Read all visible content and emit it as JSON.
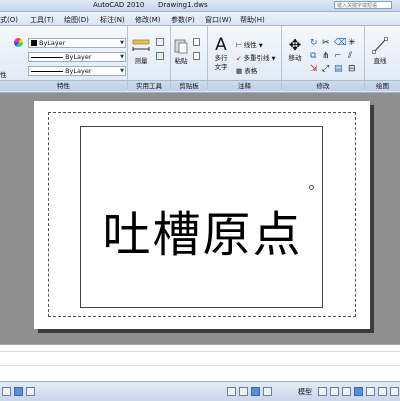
{
  "titlebar": {
    "app_title": "AutoCAD 2010",
    "document_title": "Drawing1.dws",
    "search_placeholder": "键入关键字或短语"
  },
  "menu": {
    "items": [
      "式(O)",
      "工具(T)",
      "绘图(D)",
      "标注(N)",
      "修改(M)",
      "参数(P)",
      "窗口(W)",
      "帮助(H)"
    ]
  },
  "ribbon": {
    "properties": {
      "color_value": "ByLayer",
      "linetype_value": "ByLayer",
      "lineweight_value": "ByLayer",
      "left_cut_label": "性",
      "panel_label": "特性"
    },
    "utilities": {
      "measure_label": "测量",
      "panel_label": "实用工具"
    },
    "clipboard": {
      "paste_label": "粘贴",
      "panel_label": "剪贴板"
    },
    "annotation": {
      "mtext_label_1": "多行",
      "mtext_label_2": "文字",
      "linear_label": "线性",
      "mleader_label": "多重引线",
      "table_label": "表格",
      "panel_label": "注释"
    },
    "modify": {
      "move_label": "移动",
      "panel_label": "修改"
    },
    "draw": {
      "line_label": "直线",
      "panel_label": "绘图"
    }
  },
  "drawing": {
    "text": "吐槽原点"
  },
  "statusbar": {
    "model_label": "模型"
  }
}
